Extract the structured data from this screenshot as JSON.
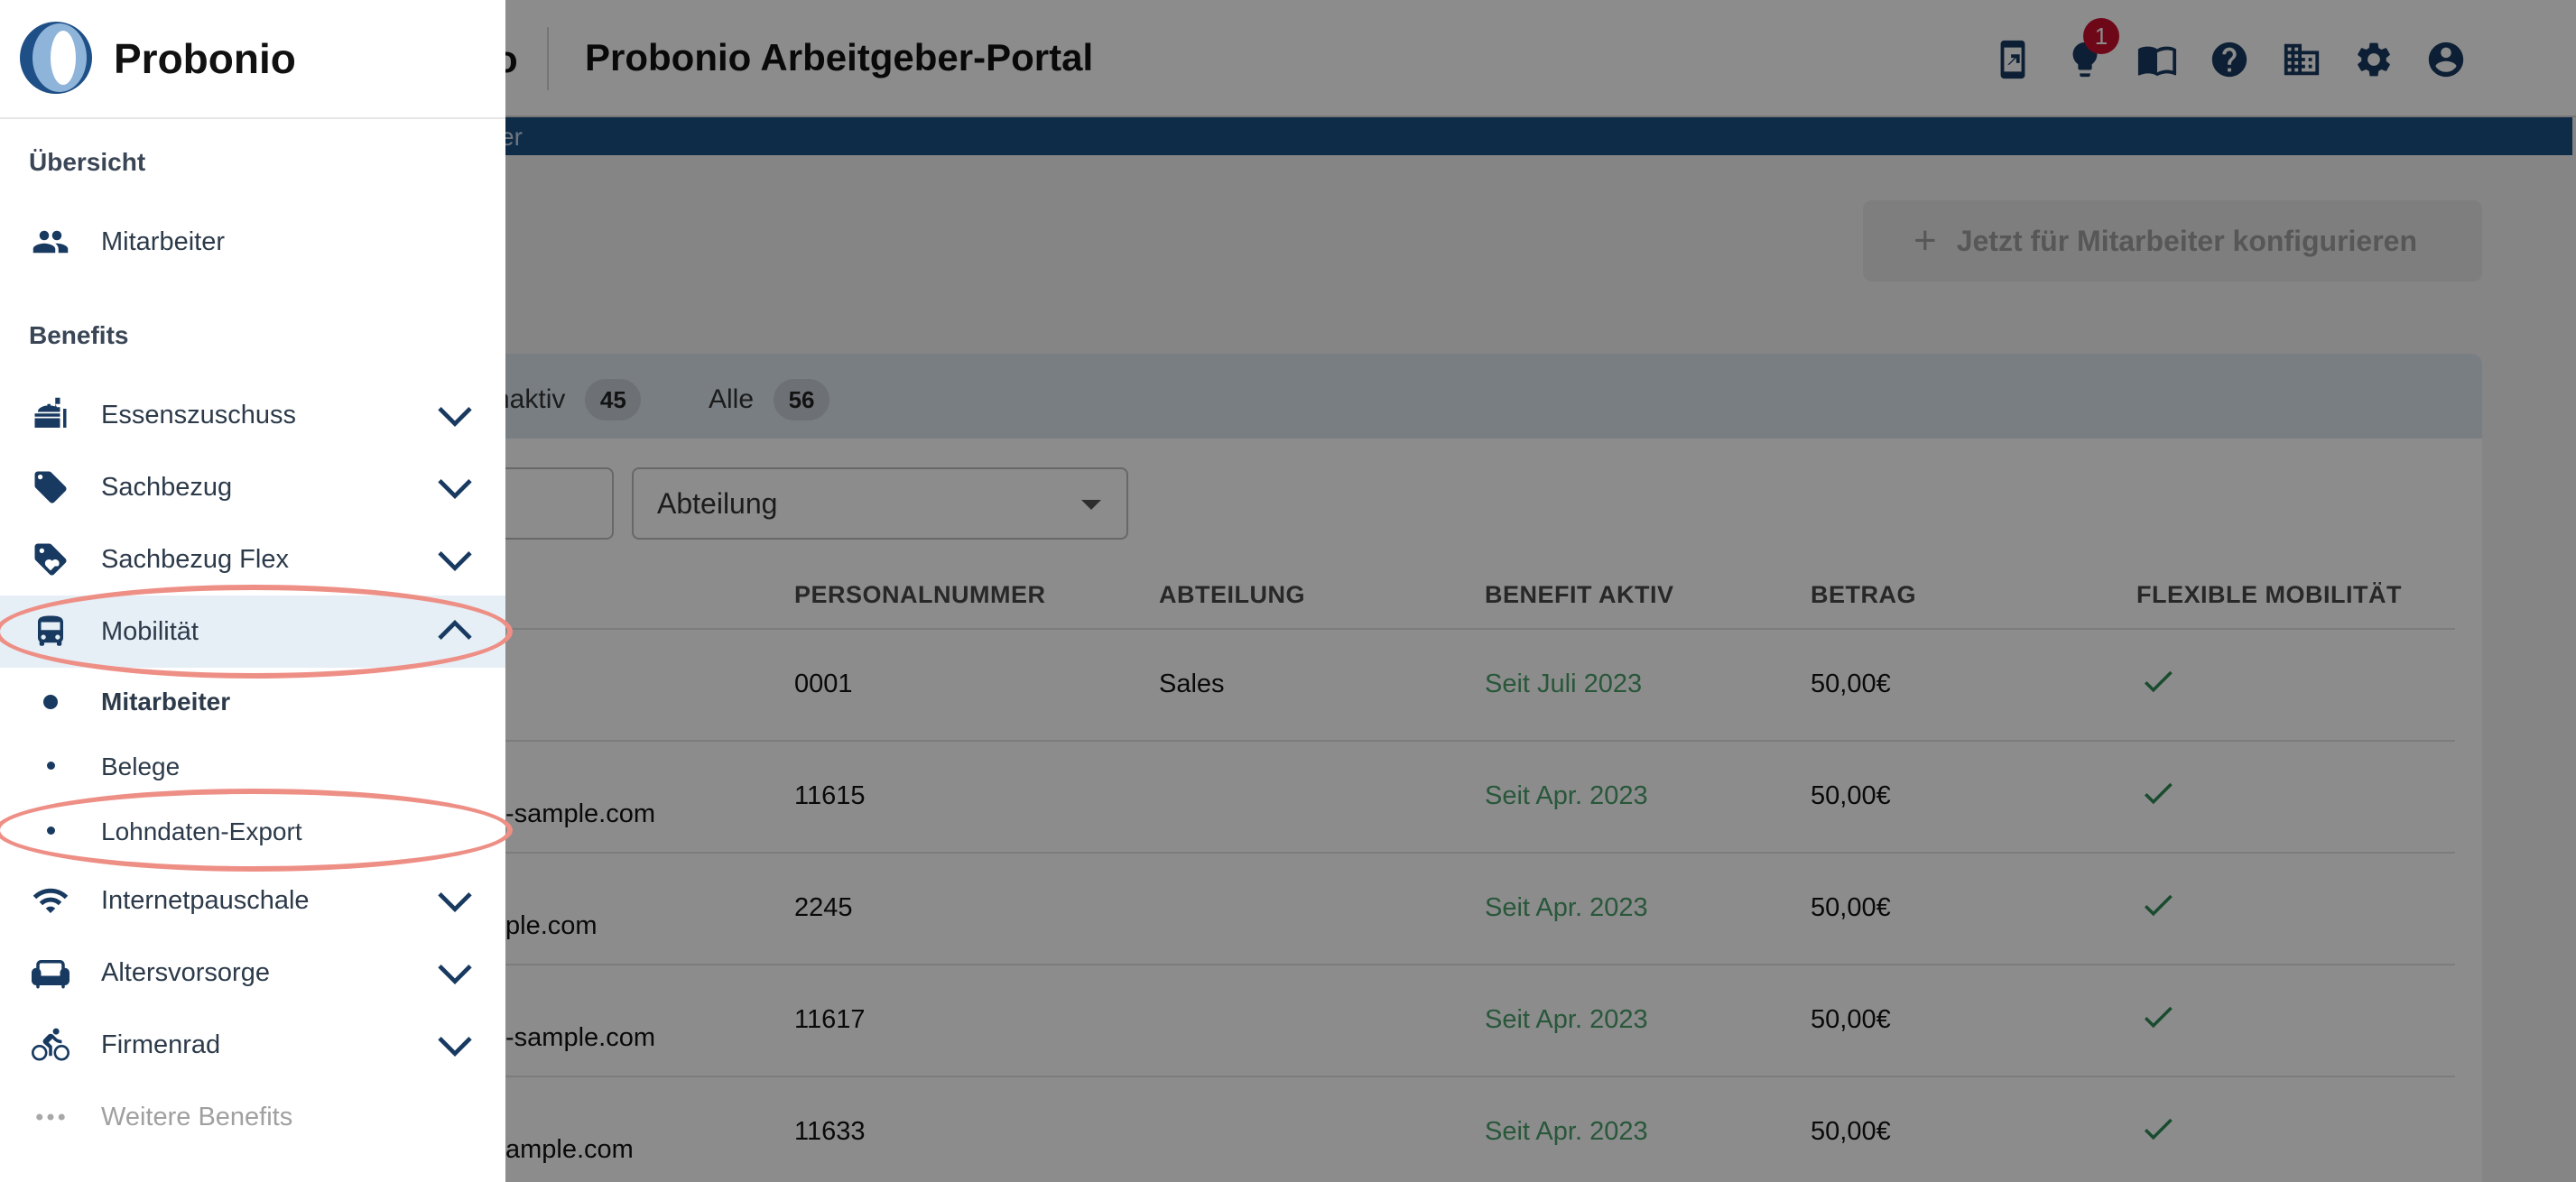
{
  "header": {
    "brand_tail": "o",
    "portal_title": "Probonio Arbeitgeber-Portal",
    "notification_count": "1",
    "icons": [
      "mobile-app-icon",
      "lightbulb-icon",
      "book-icon",
      "help-icon",
      "company-icon",
      "gear-icon",
      "account-icon"
    ]
  },
  "breadcrumb": {
    "text": "iter"
  },
  "cta": {
    "label": "Jetzt für Mitarbeiter konfigurieren"
  },
  "tabs": [
    {
      "label": "naktiv",
      "count": "45"
    },
    {
      "label": "Alle",
      "count": "56"
    }
  ],
  "filters": {
    "department_placeholder": "Abteilung"
  },
  "table": {
    "headers": [
      "PERSONALNUMMER",
      "ABTEILUNG",
      "BENEFIT AKTIV",
      "BETRAG",
      "FLEXIBLE MOBILITÄT"
    ],
    "rows": [
      {
        "email_tail": "",
        "personalnummer": "0001",
        "abteilung": "Sales",
        "benefit_aktiv": "Seit Juli 2023",
        "betrag": "50,00€",
        "flex": true
      },
      {
        "email_tail": "-sample.com",
        "personalnummer": "11615",
        "abteilung": "",
        "benefit_aktiv": "Seit Apr. 2023",
        "betrag": "50,00€",
        "flex": true
      },
      {
        "email_tail": "ple.com",
        "personalnummer": "2245",
        "abteilung": "",
        "benefit_aktiv": "Seit Apr. 2023",
        "betrag": "50,00€",
        "flex": true
      },
      {
        "email_tail": "-sample.com",
        "personalnummer": "11617",
        "abteilung": "",
        "benefit_aktiv": "Seit Apr. 2023",
        "betrag": "50,00€",
        "flex": true
      },
      {
        "email_tail": "ample.com",
        "personalnummer": "11633",
        "abteilung": "",
        "benefit_aktiv": "Seit Apr. 2023",
        "betrag": "50,00€",
        "flex": true
      }
    ]
  },
  "drawer": {
    "brand": "Probonio",
    "section_overview": "Übersicht",
    "section_benefits": "Benefits",
    "items": {
      "mitarbeiter": "Mitarbeiter",
      "essenszuschuss": "Essenszuschuss",
      "sachbezug": "Sachbezug",
      "sachbezug_flex": "Sachbezug Flex",
      "mobilitaet": "Mobilität",
      "internetpauschale": "Internetpauschale",
      "altersvorsorge": "Altersvorsorge",
      "firmenrad": "Firmenrad",
      "weitere": "Weitere Benefits"
    },
    "sub_items": {
      "mitarbeiter": "Mitarbeiter",
      "belege": "Belege",
      "lohndaten_export": "Lohndaten-Export"
    }
  },
  "colors": {
    "brand_navy": "#183a60",
    "active_bg": "#e6eef6",
    "highlight": "#ee8f86",
    "status_green": "#4b9e6b",
    "badge_red": "#c8102e"
  }
}
